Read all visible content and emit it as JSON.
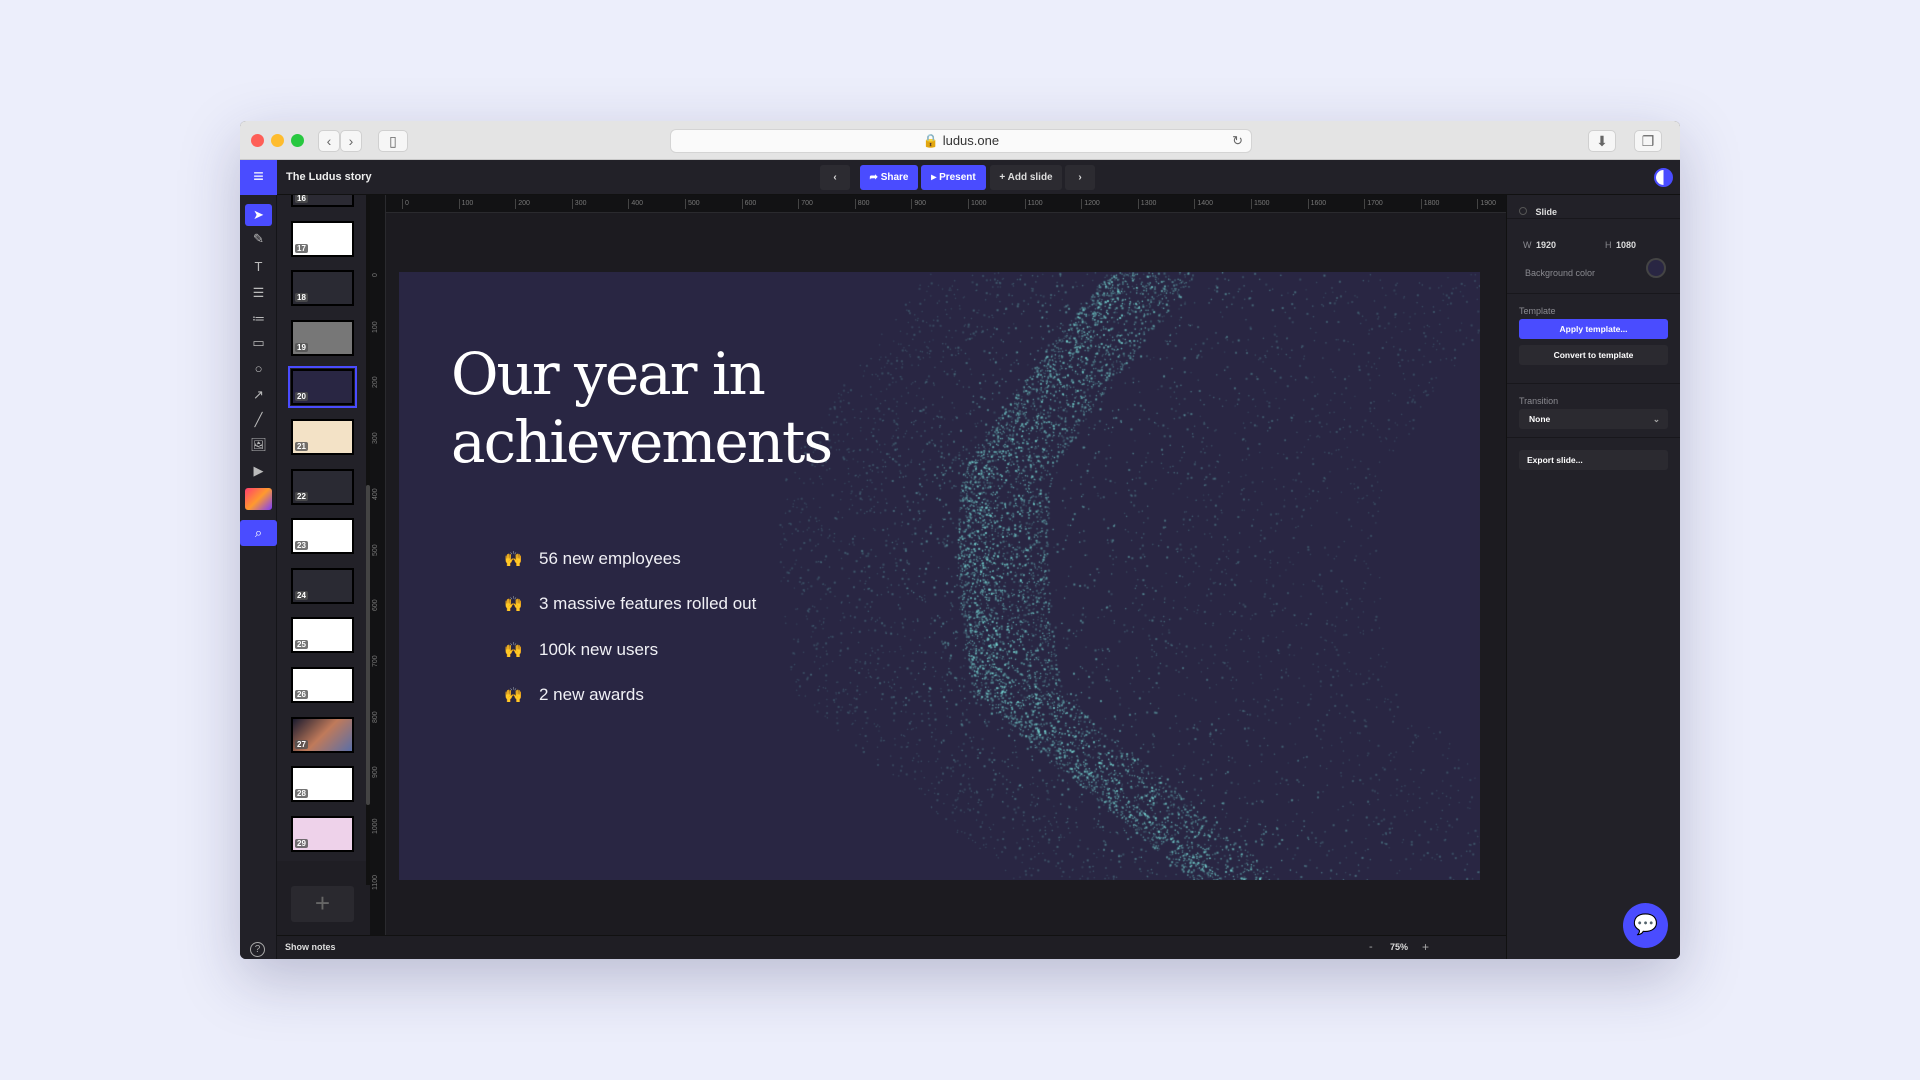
{
  "browser": {
    "url": "ludus.one",
    "back_icon": "chevron-left-icon",
    "forward_icon": "chevron-right-icon"
  },
  "app": {
    "title": "The Ludus story",
    "accent": "#4a4cff"
  },
  "toolbar": {
    "share": "Share",
    "present": "Present",
    "add_slide": "Add slide"
  },
  "tools": [
    "select",
    "pencil",
    "text",
    "paragraph",
    "list",
    "rectangle",
    "circle",
    "arrow",
    "line",
    "image",
    "video",
    "creative-cloud",
    "search"
  ],
  "thumbnails": [
    "16",
    "17",
    "18",
    "19",
    "20",
    "21",
    "22",
    "23",
    "24",
    "25",
    "26",
    "27",
    "28",
    "29"
  ],
  "selected_slide": "20",
  "hruler": [
    "0",
    "100",
    "200",
    "300",
    "400",
    "500",
    "600",
    "700",
    "800",
    "900",
    "1000",
    "1100",
    "1200",
    "1300",
    "1400",
    "1500",
    "1600",
    "1700",
    "1800",
    "1900"
  ],
  "vruler": [
    "0",
    "100",
    "200",
    "300",
    "400",
    "500",
    "600",
    "700",
    "800",
    "900",
    "1000",
    "1100"
  ],
  "slide": {
    "title_line1": "Our year in",
    "title_line2": "achievements",
    "background": "#292643",
    "bullets": [
      {
        "emoji": "🙌",
        "text": "56 new employees"
      },
      {
        "emoji": "🙌",
        "text": "3 massive features rolled out"
      },
      {
        "emoji": "🙌",
        "text": "100k new users"
      },
      {
        "emoji": "🙌",
        "text": "2 new awards"
      }
    ]
  },
  "panel": {
    "header": "Slide",
    "w_label": "W",
    "w": "1920",
    "h_label": "H",
    "h": "1080",
    "bg_label": "Background color",
    "template_label": "Template",
    "apply": "Apply template...",
    "convert": "Convert to template",
    "transition_label": "Transition",
    "transition": "None",
    "export": "Export slide..."
  },
  "bottom": {
    "show_notes": "Show notes",
    "zoom": "75%",
    "minus": "-",
    "plus": "+"
  }
}
